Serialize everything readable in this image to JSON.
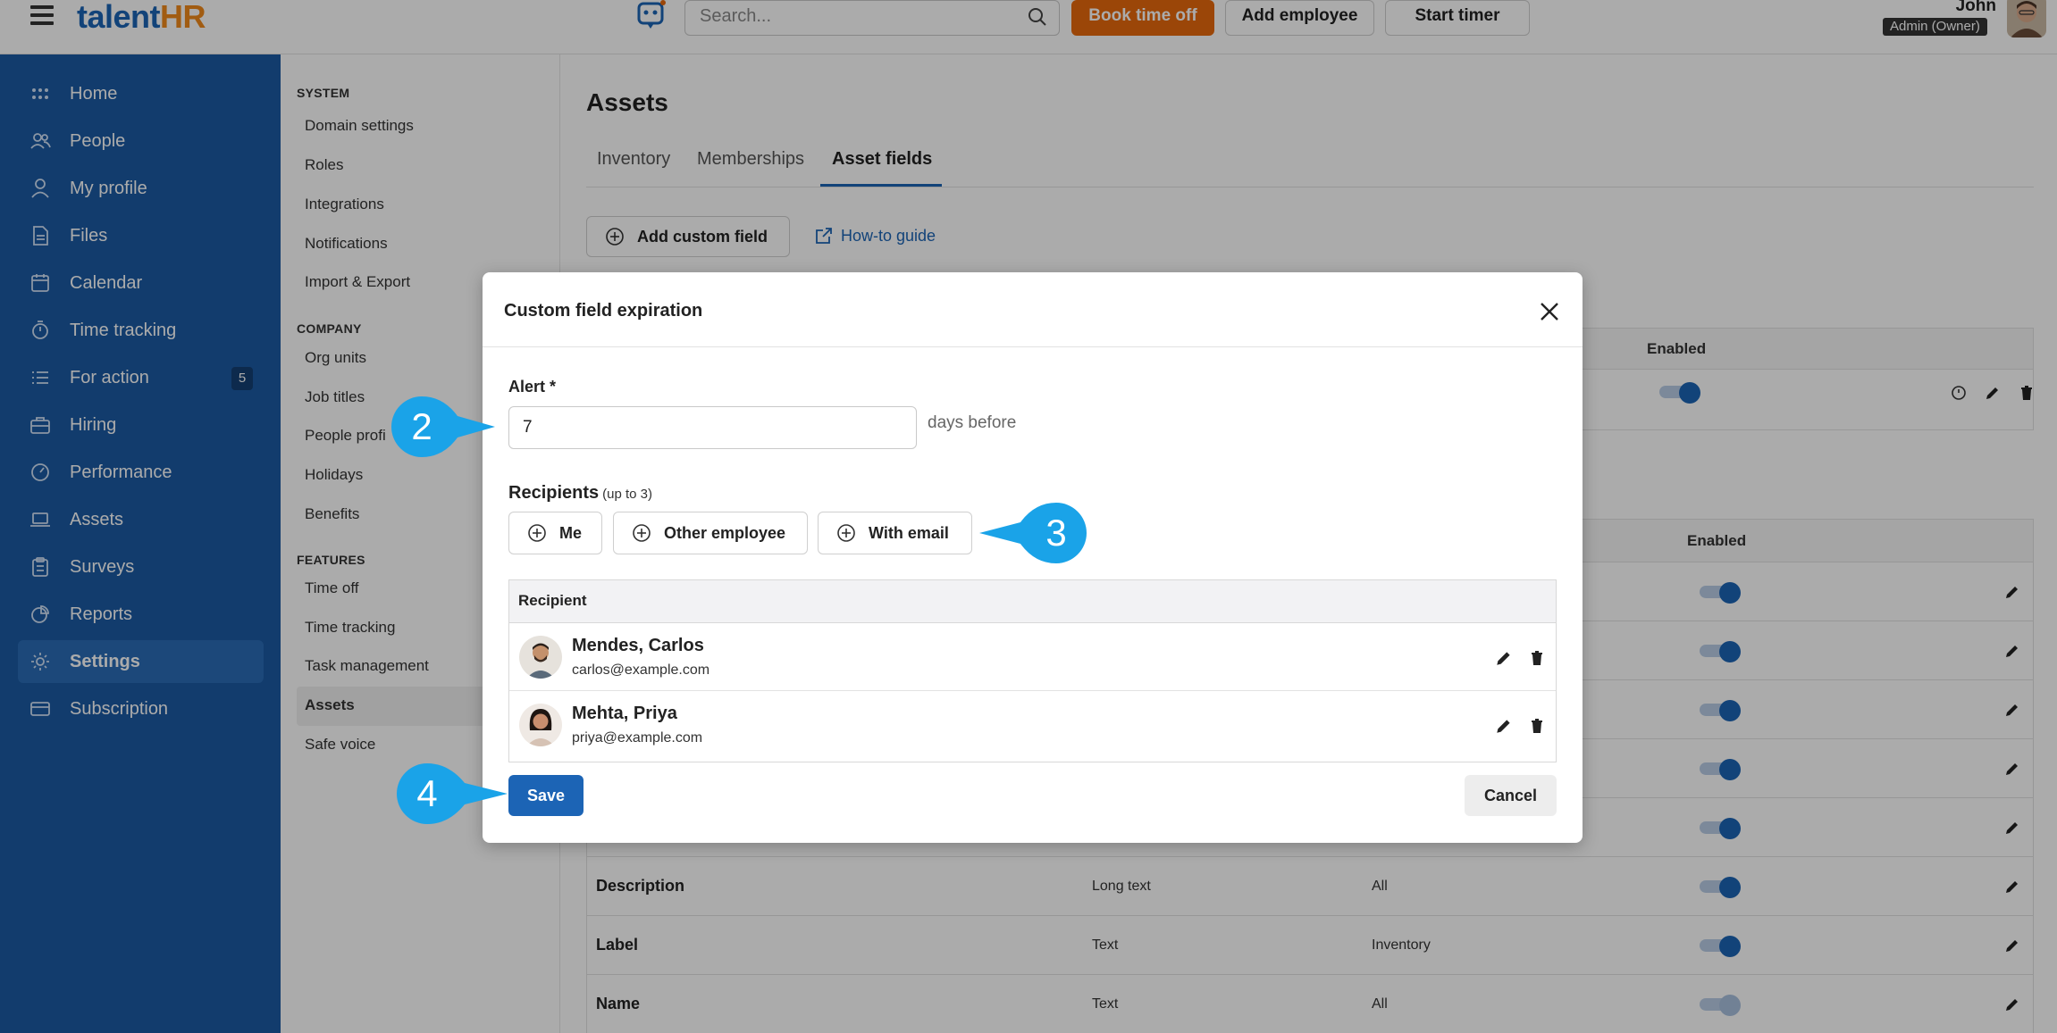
{
  "app": {
    "logo_part1": "talent",
    "logo_part2": "HR",
    "search_placeholder": "Search...",
    "buttons": {
      "book_time_off": "Book time off",
      "add_employee": "Add employee",
      "start_timer": "Start timer"
    },
    "user": {
      "name": "John",
      "role": "Admin (Owner)"
    }
  },
  "sidebar": {
    "items": [
      {
        "label": "Home",
        "icon": "grid-icon"
      },
      {
        "label": "People",
        "icon": "people-icon"
      },
      {
        "label": "My profile",
        "icon": "person-icon"
      },
      {
        "label": "Files",
        "icon": "file-icon"
      },
      {
        "label": "Calendar",
        "icon": "calendar-icon"
      },
      {
        "label": "Time tracking",
        "icon": "stopwatch-icon"
      },
      {
        "label": "For action",
        "icon": "list-icon",
        "badge": "5"
      },
      {
        "label": "Hiring",
        "icon": "briefcase-icon"
      },
      {
        "label": "Performance",
        "icon": "gauge-icon"
      },
      {
        "label": "Assets",
        "icon": "laptop-icon"
      },
      {
        "label": "Surveys",
        "icon": "clipboard-icon"
      },
      {
        "label": "Reports",
        "icon": "pie-chart-icon"
      },
      {
        "label": "Settings",
        "icon": "gear-icon",
        "active": true
      },
      {
        "label": "Subscription",
        "icon": "card-icon"
      }
    ]
  },
  "settings_nav": {
    "system_header": "SYSTEM",
    "system_items": [
      "Domain settings",
      "Roles",
      "Integrations",
      "Notifications",
      "Import & Export"
    ],
    "company_header": "COMPANY",
    "company_items": [
      "Org units",
      "Job titles",
      "People profi",
      "Holidays",
      "Benefits"
    ],
    "features_header": "FEATURES",
    "features_items": [
      "Time off",
      "Time tracking",
      "Task management",
      "Assets",
      "Safe voice"
    ],
    "active_item": "Assets"
  },
  "main": {
    "title": "Assets",
    "tabs": [
      "Inventory",
      "Memberships",
      "Asset fields"
    ],
    "active_tab": "Asset fields",
    "add_custom_field": "Add custom field",
    "how_to_guide": "How-to guide",
    "table1": {
      "enabled_header": "Enabled"
    },
    "table2": {
      "enabled_header": "Enabled",
      "rows": [
        {
          "name": "Description",
          "type": "Long text",
          "scope": "All",
          "enabled": true
        },
        {
          "name": "Label",
          "type": "Text",
          "scope": "Inventory",
          "enabled": true
        },
        {
          "name": "Name",
          "type": "Text",
          "scope": "All",
          "enabled": false
        }
      ]
    }
  },
  "modal": {
    "title": "Custom field expiration",
    "alert_label": "Alert *",
    "alert_value": "7",
    "days_before": "days before",
    "recipients_label": "Recipients",
    "recipients_hint": "(up to 3)",
    "buttons": {
      "me": "Me",
      "other_employee": "Other employee",
      "with_email": "With email"
    },
    "table_header": "Recipient",
    "recipients": [
      {
        "name": "Mendes, Carlos",
        "email": "carlos@example.com"
      },
      {
        "name": "Mehta, Priya",
        "email": "priya@example.com"
      }
    ],
    "save": "Save",
    "cancel": "Cancel"
  },
  "callouts": [
    "2",
    "3",
    "4"
  ],
  "colors": {
    "brand_blue": "#1c64b5",
    "sidebar_blue": "#1b5aa3",
    "orange": "#e8690c",
    "callout": "#1aa3e8"
  }
}
